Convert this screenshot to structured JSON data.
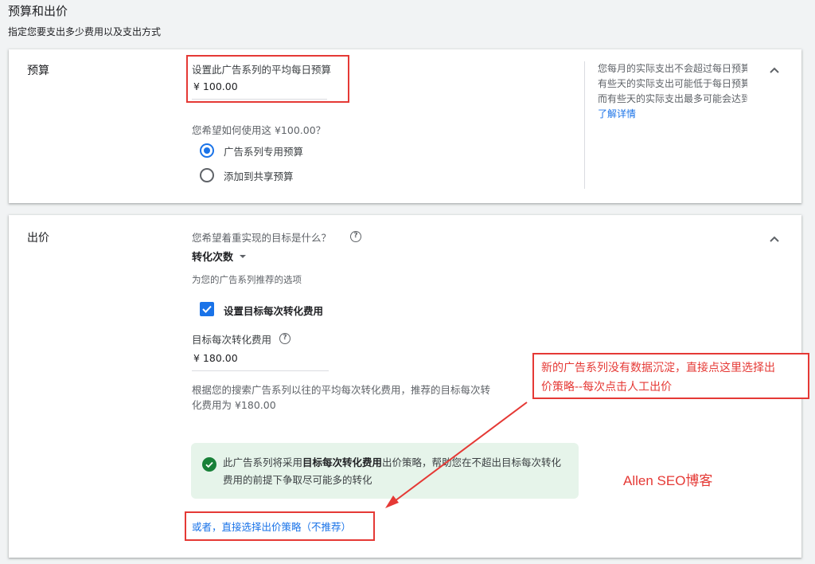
{
  "header": {
    "title": "预算和出价",
    "subtitle": "指定您要支出多少费用以及支出方式"
  },
  "budget": {
    "section_title": "预算",
    "daily_budget_label": "设置此广告系列的平均每日预算",
    "daily_budget_value": "¥ 100.00",
    "usage_question": "您希望如何使用这 ¥100.00？",
    "options": [
      {
        "label": "广告系列专用预算",
        "selected": true
      },
      {
        "label": "添加到共享预算",
        "selected": false
      }
    ],
    "info_lines": [
      "您每月的实际支出不会超过每日预算",
      "有些天的实际支出可能低于每日预算，",
      "而有些天的实际支出最多可能会达到"
    ],
    "learn_more": "了解详情"
  },
  "bidding": {
    "section_title": "出价",
    "goal_question": "您希望着重实现的目标是什么？",
    "goal_value": "转化次数",
    "recommended_hint": "为您的广告系列推荐的选项",
    "target_cpa_checkbox_label": "设置目标每次转化费用",
    "target_cpa_checked": true,
    "target_cpa_label": "目标每次转化费用",
    "target_cpa_value": "¥ 180.00",
    "recommendation_line1": "根据您的搜索广告系列以往的平均每次转化费用，推荐的目标每次转",
    "recommendation_line2": "化费用为 ¥180.00",
    "notice_pre": "此广告系列将采用",
    "notice_bold": "目标每次转化费用",
    "notice_post": "出价策略，帮助您在不超出目标每次转化费用的前提下争取尽可能多的转化",
    "direct_strategy_link": "或者，直接选择出价策略（不推荐）"
  },
  "annotations": {
    "callout_line1": "新的广告系列没有数据沉淀，直接点这里选择出",
    "callout_line2": "价策略--每次点击人工出价",
    "brand": "Allen SEO博客",
    "color": "#e53935"
  }
}
